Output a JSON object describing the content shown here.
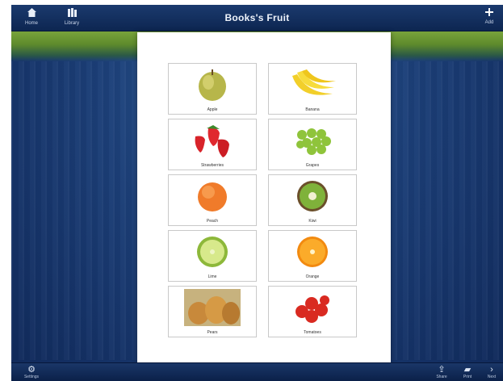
{
  "toolbar": {
    "title": "Books's Fruit",
    "left_buttons": [
      {
        "label": "Home",
        "icon": "home-icon"
      },
      {
        "label": "Library",
        "icon": "library-icon"
      }
    ],
    "right_button": {
      "label": "Add",
      "icon": "plus-icon"
    }
  },
  "page": {
    "cards": [
      {
        "label": "Apple",
        "icon": "apple-icon"
      },
      {
        "label": "Banana",
        "icon": "banana-icon"
      },
      {
        "label": "Strawberries",
        "icon": "strawberry-icon"
      },
      {
        "label": "Grapes",
        "icon": "grapes-icon"
      },
      {
        "label": "Peach",
        "icon": "peach-icon"
      },
      {
        "label": "Kiwi",
        "icon": "kiwi-icon"
      },
      {
        "label": "Lime",
        "icon": "lime-icon"
      },
      {
        "label": "Orange",
        "icon": "orange-icon"
      },
      {
        "label": "Pears",
        "icon": "pear-icon"
      },
      {
        "label": "Tomatoes",
        "icon": "tomato-icon"
      }
    ]
  },
  "bottombar": {
    "left_button": {
      "label": "Settings",
      "icon": "gear-icon"
    },
    "right_buttons": [
      {
        "label": "Share",
        "icon": "share-icon"
      },
      {
        "label": "Print",
        "icon": "print-icon"
      },
      {
        "label": "Next",
        "icon": "chevron-right-icon"
      }
    ]
  },
  "colors": {
    "bar": "#0d2651",
    "background": "#1c3f78",
    "accent_green": "#7aa53c"
  }
}
